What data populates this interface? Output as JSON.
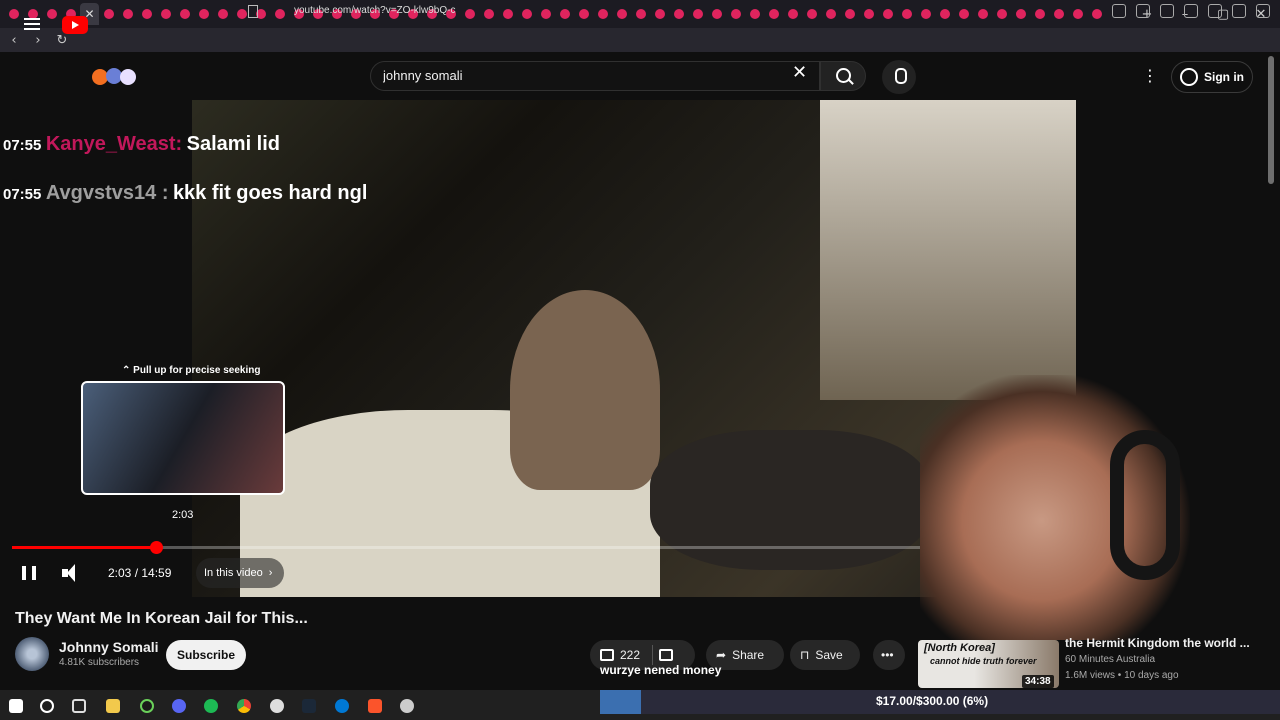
{
  "browser": {
    "url": "youtube.com/watch?v=ZO-klw9bQ-c",
    "tab_count": 58
  },
  "search": {
    "value": "johnny somali"
  },
  "header": {
    "sign_in_label": "Sign in"
  },
  "stream_chat": [
    {
      "time": "07:55",
      "user": "Kanye_Weast:",
      "message": "Salami lid",
      "user_color": "#c2185b"
    },
    {
      "time": "07:55",
      "user": "Avgvstvs14 :",
      "message": "kkk fit goes hard ngl",
      "user_color": "#9e9e9e"
    }
  ],
  "player": {
    "seek_hint": "Pull up for precise seeking",
    "preview_time": "2:03",
    "current_time": "2:03",
    "duration": "14:59",
    "time_display": "2:03 / 14:59",
    "progress_fraction": 0.1368,
    "chapters_label": "In this video",
    "accent_color": "#ff0000"
  },
  "video": {
    "title": "They Want Me In Korean Jail for This...",
    "channel_name": "Johnny Somali",
    "subscriber_count": "4.81K subscribers",
    "subscribe_label": "Subscribe",
    "like_count": "222",
    "share_label": "Share",
    "save_label": "Save"
  },
  "overlay": {
    "donation_text": "wurzye nened money",
    "goal_text": "$17.00/$300.00 (6%)",
    "goal_fraction": 0.06
  },
  "related_video": {
    "thumb_caption": "[North Korea]",
    "thumb_sub_caption": "cannot hide truth forever",
    "duration": "34:38",
    "title": "the Hermit Kingdom the world ...",
    "channel": "60 Minutes Australia",
    "meta": "1.6M views • 10 days ago"
  },
  "icons": {
    "menu": "hamburger-icon",
    "search": "search-icon",
    "mic": "mic-icon",
    "clear": "close-icon",
    "account": "account-icon",
    "like": "thumbs-up-icon",
    "dislike": "thumbs-down-icon",
    "share": "share-icon",
    "save": "bookmark-icon",
    "more": "more-icon",
    "pause": "pause-icon",
    "volume": "volume-icon"
  }
}
